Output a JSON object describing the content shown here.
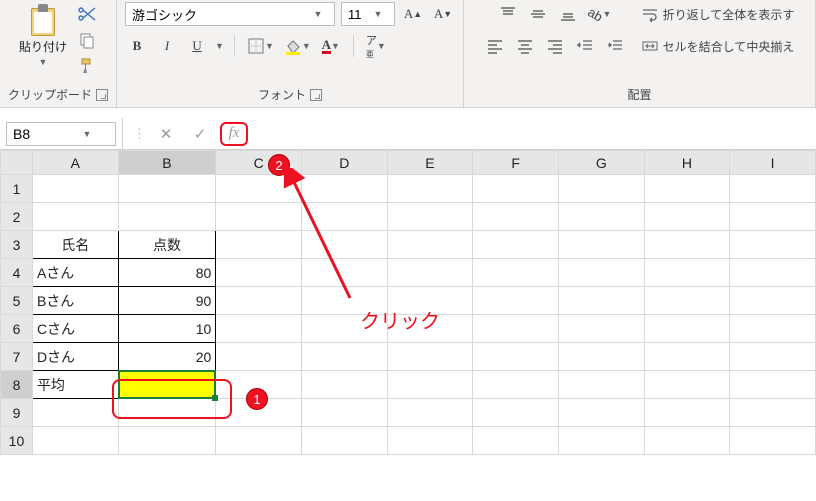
{
  "ribbon": {
    "font": {
      "family": "游ゴシック",
      "size": "11",
      "bold": "B",
      "italic": "I",
      "underline": "U"
    },
    "groups": {
      "clipboard": "クリップボード",
      "font": "フォント",
      "alignment": "配置"
    },
    "paste_label": "貼り付け",
    "alignment": {
      "wrap": "折り返して全体を表示す",
      "merge": "セルを結合して中央揃え"
    }
  },
  "namebox": "B8",
  "formula": "",
  "columns": [
    "A",
    "B",
    "C",
    "D",
    "E",
    "F",
    "G",
    "H",
    "I"
  ],
  "rows": [
    "1",
    "2",
    "3",
    "4",
    "5",
    "6",
    "7",
    "8",
    "9",
    "10"
  ],
  "sheet": {
    "A3": "氏名",
    "B3": "点数",
    "A4": "Aさん",
    "B4": "80",
    "A5": "Bさん",
    "B5": "90",
    "A6": "Cさん",
    "B6": "10",
    "A7": "Dさん",
    "B7": "20",
    "A8": "平均"
  },
  "anno": {
    "click": "クリック",
    "b1": "1",
    "b2": "2"
  },
  "chart_data": {
    "type": "table",
    "title": "",
    "columns": [
      "氏名",
      "点数"
    ],
    "rows": [
      [
        "Aさん",
        80
      ],
      [
        "Bさん",
        90
      ],
      [
        "Cさん",
        10
      ],
      [
        "Dさん",
        20
      ]
    ],
    "summary_row": {
      "label": "平均",
      "value": null
    }
  }
}
